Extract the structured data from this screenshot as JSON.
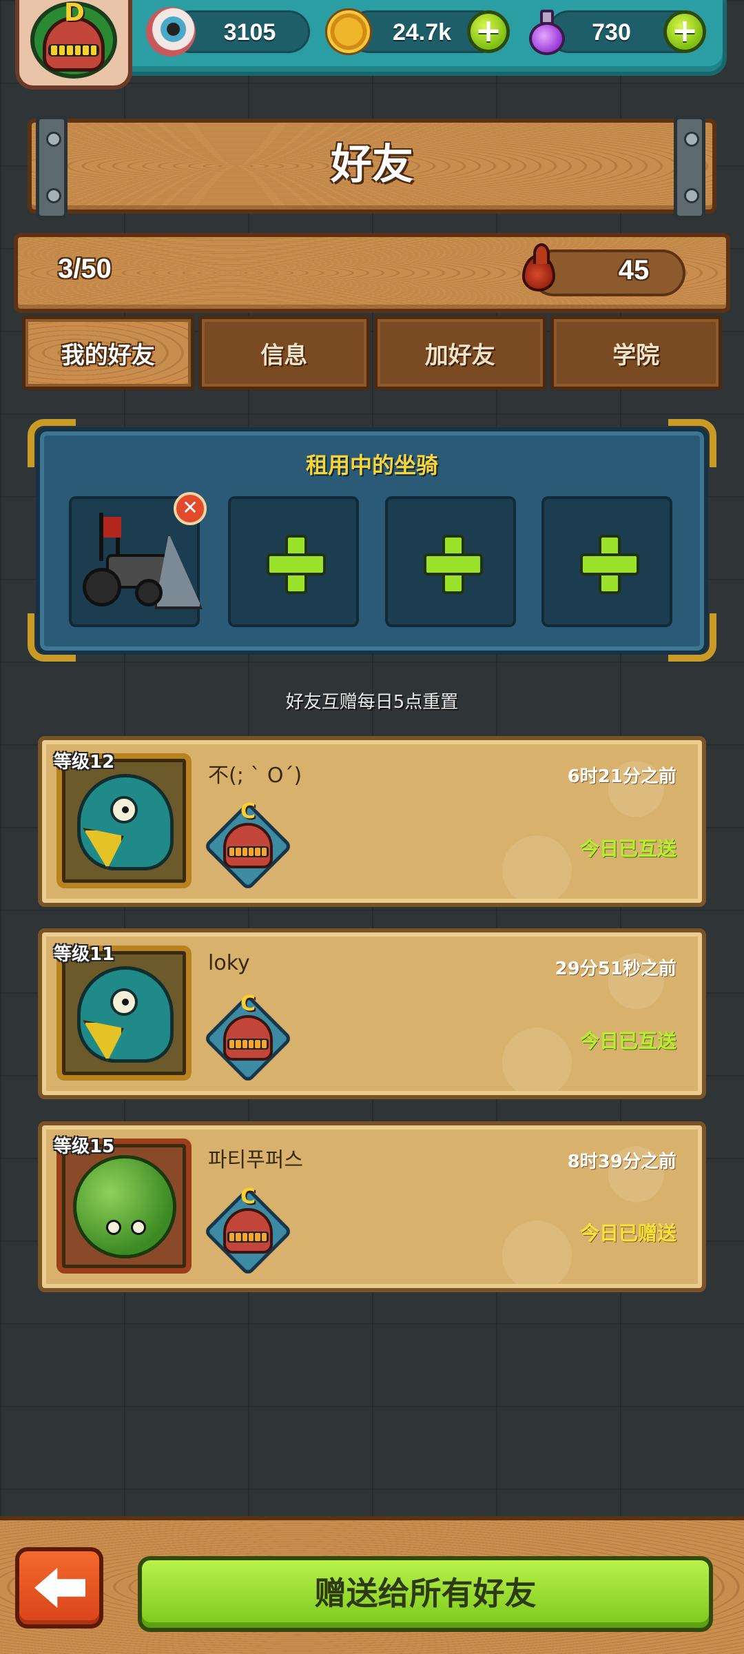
{
  "header": {
    "player_grade": "D",
    "resources": {
      "eyes": "3105",
      "coins": "24.7k",
      "potions": "730"
    },
    "icons": [
      "eyeball-icon",
      "coin-icon",
      "potion-icon",
      "plus-icon"
    ]
  },
  "title": "好友",
  "info": {
    "friend_count": "3/50",
    "blood": "45"
  },
  "tabs": [
    {
      "label": "我的好友",
      "active": true
    },
    {
      "label": "信息",
      "active": false
    },
    {
      "label": "加好友",
      "active": false
    },
    {
      "label": "学院",
      "active": false
    }
  ],
  "mount_panel": {
    "title": "租用中的坐骑",
    "slots": [
      "occupied",
      "empty",
      "empty",
      "empty"
    ]
  },
  "notice": "好友互赠每日5点重置",
  "friends": [
    {
      "level": "等级12",
      "name": "不(; ` O´)",
      "time": "6时21分之前",
      "status": "今日已互送",
      "status_color": "#b6f02a",
      "badge_grade": "C"
    },
    {
      "level": "等级11",
      "name": "loky",
      "time": "29分51秒之前",
      "status": "今日已互送",
      "status_color": "#b6f02a",
      "badge_grade": "C"
    },
    {
      "level": "等级15",
      "name": "파티푸퍼스",
      "time": "8时39分之前",
      "status": "今日已赠送",
      "status_color": "#f7e23a",
      "badge_grade": "C"
    }
  ],
  "footer": {
    "gift_all_label": "赠送给所有好友"
  },
  "colors": {
    "accent_green": "#9be32a",
    "wood": "#c98e4e",
    "panel_blue": "#2a5a75"
  }
}
